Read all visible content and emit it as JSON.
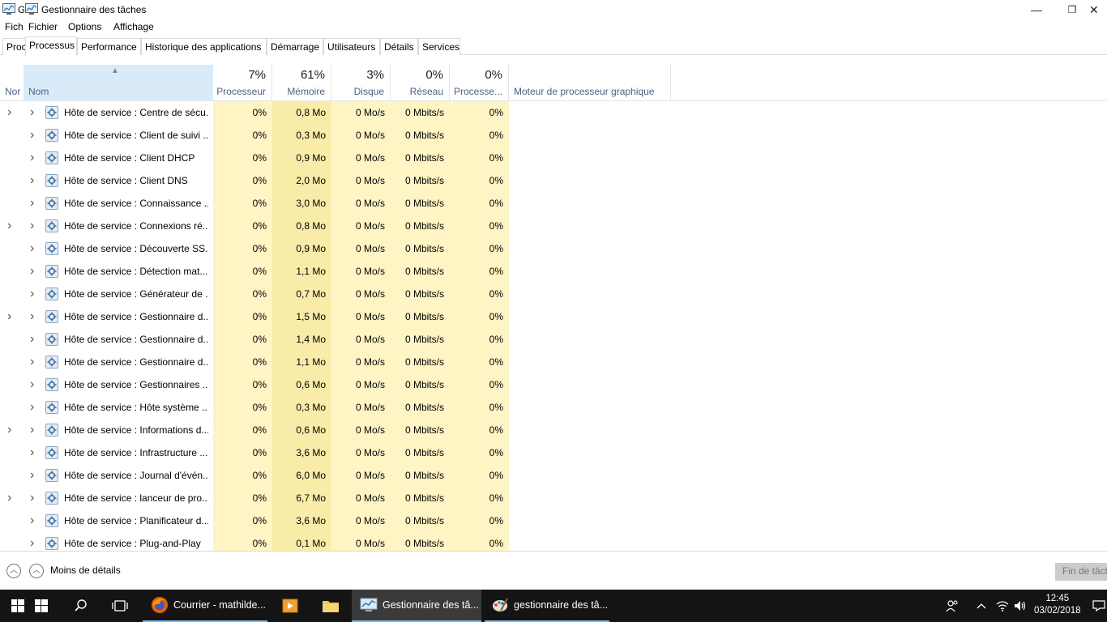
{
  "window": {
    "title_fragment": "G",
    "title": "Gestionnaire des tâches",
    "minimize": "—",
    "restore": "❐",
    "close": "✕"
  },
  "menu": {
    "ghost": "Fich",
    "file": "Fichier",
    "options": "Options",
    "view": "Affichage"
  },
  "tabs": {
    "ghost": "Proc",
    "items": [
      "Processus",
      "Performance",
      "Historique des applications",
      "Démarrage",
      "Utilisateurs",
      "Détails",
      "Services"
    ],
    "active": "Processus"
  },
  "columns": {
    "ghost_name": "Nor",
    "name": "Nom",
    "cpu": {
      "pct": "7%",
      "label": "Processeur"
    },
    "memory": {
      "pct": "61%",
      "label": "Mémoire"
    },
    "disk": {
      "pct": "3%",
      "label": "Disque"
    },
    "network": {
      "pct": "0%",
      "label": "Réseau"
    },
    "gpu": {
      "pct": "0%",
      "label": "Processe..."
    },
    "gpu_engine": {
      "label": "Moteur de processeur graphique"
    }
  },
  "rows": [
    {
      "name": "Hôte de service : Centre de sécu...",
      "cpu": "0%",
      "mem": "0,8 Mo",
      "disk": "0 Mo/s",
      "net": "0 Mbits/s",
      "gpu": "0%",
      "ghost_expander": true
    },
    {
      "name": "Hôte de service : Client de suivi ...",
      "cpu": "0%",
      "mem": "0,3 Mo",
      "disk": "0 Mo/s",
      "net": "0 Mbits/s",
      "gpu": "0%",
      "ghost_expander": false
    },
    {
      "name": "Hôte de service : Client DHCP",
      "cpu": "0%",
      "mem": "0,9 Mo",
      "disk": "0 Mo/s",
      "net": "0 Mbits/s",
      "gpu": "0%",
      "ghost_expander": false
    },
    {
      "name": "Hôte de service : Client DNS",
      "cpu": "0%",
      "mem": "2,0 Mo",
      "disk": "0 Mo/s",
      "net": "0 Mbits/s",
      "gpu": "0%",
      "ghost_expander": false
    },
    {
      "name": "Hôte de service : Connaissance ...",
      "cpu": "0%",
      "mem": "3,0 Mo",
      "disk": "0 Mo/s",
      "net": "0 Mbits/s",
      "gpu": "0%",
      "ghost_expander": false
    },
    {
      "name": "Hôte de service : Connexions ré...",
      "cpu": "0%",
      "mem": "0,8 Mo",
      "disk": "0 Mo/s",
      "net": "0 Mbits/s",
      "gpu": "0%",
      "ghost_expander": true
    },
    {
      "name": "Hôte de service : Découverte SS...",
      "cpu": "0%",
      "mem": "0,9 Mo",
      "disk": "0 Mo/s",
      "net": "0 Mbits/s",
      "gpu": "0%",
      "ghost_expander": false
    },
    {
      "name": "Hôte de service : Détection mat...",
      "cpu": "0%",
      "mem": "1,1 Mo",
      "disk": "0 Mo/s",
      "net": "0 Mbits/s",
      "gpu": "0%",
      "ghost_expander": false
    },
    {
      "name": "Hôte de service : Générateur de ...",
      "cpu": "0%",
      "mem": "0,7 Mo",
      "disk": "0 Mo/s",
      "net": "0 Mbits/s",
      "gpu": "0%",
      "ghost_expander": false
    },
    {
      "name": "Hôte de service : Gestionnaire d...",
      "cpu": "0%",
      "mem": "1,5 Mo",
      "disk": "0 Mo/s",
      "net": "0 Mbits/s",
      "gpu": "0%",
      "ghost_expander": true
    },
    {
      "name": "Hôte de service : Gestionnaire d...",
      "cpu": "0%",
      "mem": "1,4 Mo",
      "disk": "0 Mo/s",
      "net": "0 Mbits/s",
      "gpu": "0%",
      "ghost_expander": false
    },
    {
      "name": "Hôte de service : Gestionnaire d...",
      "cpu": "0%",
      "mem": "1,1 Mo",
      "disk": "0 Mo/s",
      "net": "0 Mbits/s",
      "gpu": "0%",
      "ghost_expander": false
    },
    {
      "name": "Hôte de service : Gestionnaires ...",
      "cpu": "0%",
      "mem": "0,6 Mo",
      "disk": "0 Mo/s",
      "net": "0 Mbits/s",
      "gpu": "0%",
      "ghost_expander": false
    },
    {
      "name": "Hôte de service : Hôte système ...",
      "cpu": "0%",
      "mem": "0,3 Mo",
      "disk": "0 Mo/s",
      "net": "0 Mbits/s",
      "gpu": "0%",
      "ghost_expander": false
    },
    {
      "name": "Hôte de service : Informations d...",
      "cpu": "0%",
      "mem": "0,6 Mo",
      "disk": "0 Mo/s",
      "net": "0 Mbits/s",
      "gpu": "0%",
      "ghost_expander": true
    },
    {
      "name": "Hôte de service : Infrastructure ...",
      "cpu": "0%",
      "mem": "3,6 Mo",
      "disk": "0 Mo/s",
      "net": "0 Mbits/s",
      "gpu": "0%",
      "ghost_expander": false
    },
    {
      "name": "Hôte de service : Journal d'évén...",
      "cpu": "0%",
      "mem": "6,0 Mo",
      "disk": "0 Mo/s",
      "net": "0 Mbits/s",
      "gpu": "0%",
      "ghost_expander": false
    },
    {
      "name": "Hôte de service : lanceur de pro...",
      "cpu": "0%",
      "mem": "6,7 Mo",
      "disk": "0 Mo/s",
      "net": "0 Mbits/s",
      "gpu": "0%",
      "ghost_expander": true
    },
    {
      "name": "Hôte de service : Planificateur d...",
      "cpu": "0%",
      "mem": "3,6 Mo",
      "disk": "0 Mo/s",
      "net": "0 Mbits/s",
      "gpu": "0%",
      "ghost_expander": false
    },
    {
      "name": "Hôte de service : Plug-and-Play",
      "cpu": "0%",
      "mem": "0,1 Mo",
      "disk": "0 Mo/s",
      "net": "0 Mbits/s",
      "gpu": "0%",
      "ghost_expander": false
    }
  ],
  "footer": {
    "less_details": "Moins de détails",
    "end_task": "Fin de tâche"
  },
  "taskbar": {
    "items": [
      {
        "label": "Courrier - mathilde...",
        "icon": "firefox-icon"
      },
      {
        "label": "Gestionnaire des tâ...",
        "icon": "task-manager-icon"
      },
      {
        "label": "gestionnaire des tâ...",
        "icon": "paint-icon"
      }
    ],
    "time": "12:45",
    "date": "03/02/2018"
  },
  "colors": {
    "heat_light": "#fff4c4",
    "heat_medium": "#f9eca8",
    "header_selected": "#d9ebf9",
    "taskbar": "#141414",
    "accent": "#76b9ed"
  }
}
